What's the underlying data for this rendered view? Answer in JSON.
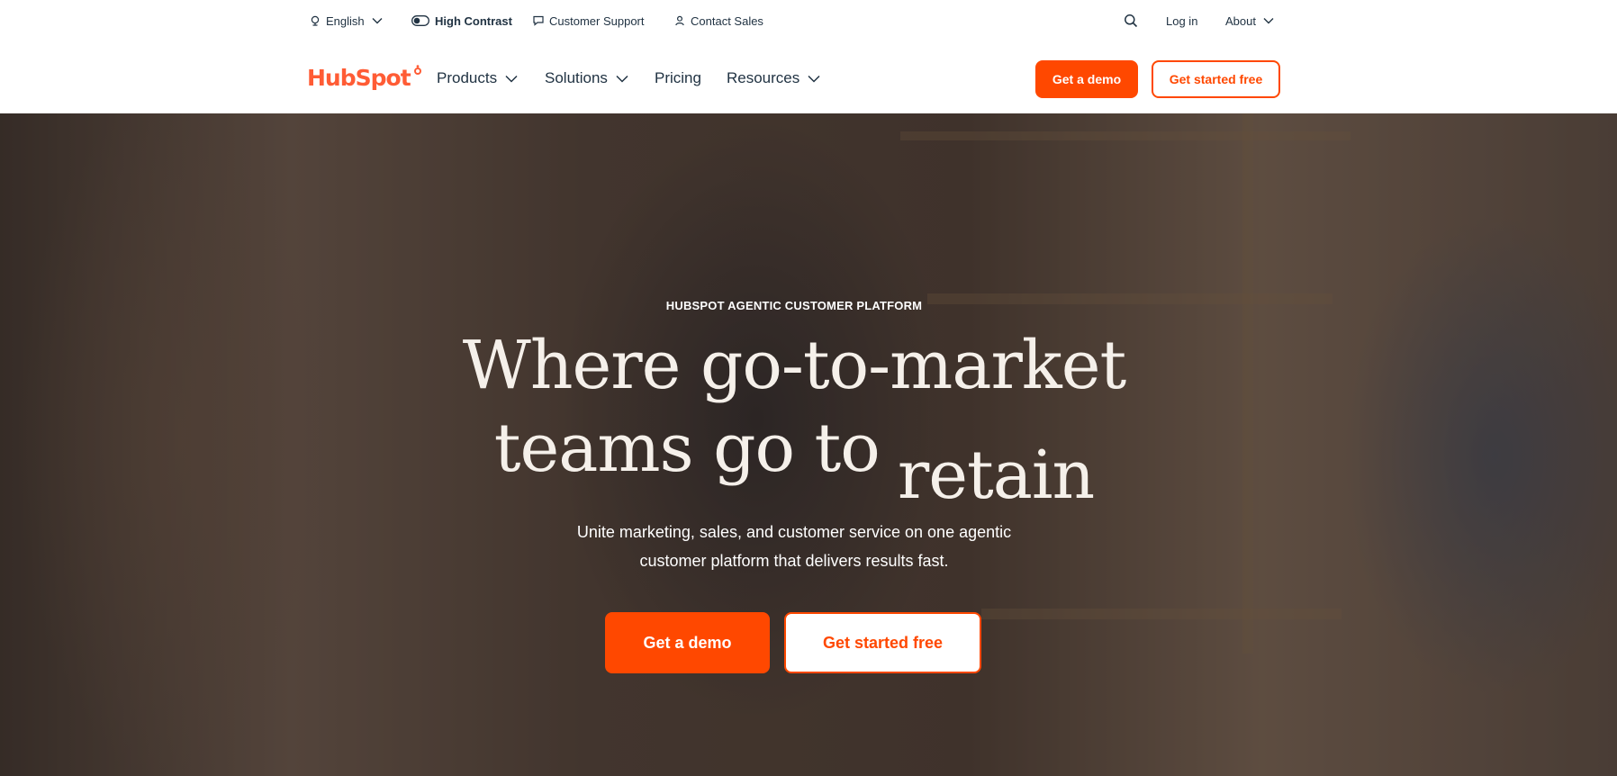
{
  "utility_nav": {
    "language": "English",
    "high_contrast": "High Contrast",
    "customer_support": "Customer Support",
    "contact_sales": "Contact Sales",
    "login": "Log in",
    "about": "About"
  },
  "main_nav": {
    "logo_text": "HubSpot",
    "items": [
      {
        "label": "Products"
      },
      {
        "label": "Solutions"
      },
      {
        "label": "Pricing"
      },
      {
        "label": "Resources"
      }
    ],
    "demo_button": "Get a demo",
    "start_button": "Get started free"
  },
  "hero": {
    "eyebrow": "HUBSPOT AGENTIC CUSTOMER PLATFORM",
    "headline_line1": "Where go-to-market",
    "headline_line2": "teams go to",
    "rotating_word": "retain",
    "subtitle_line1": "Unite marketing, sales, and customer service on one agentic",
    "subtitle_line2": "customer platform that delivers results fast.",
    "demo_button": "Get a demo",
    "start_button": "Get started free"
  },
  "colors": {
    "brand_orange": "#ff4800",
    "logo_orange": "#ff5c35",
    "text_dark": "#213343"
  }
}
